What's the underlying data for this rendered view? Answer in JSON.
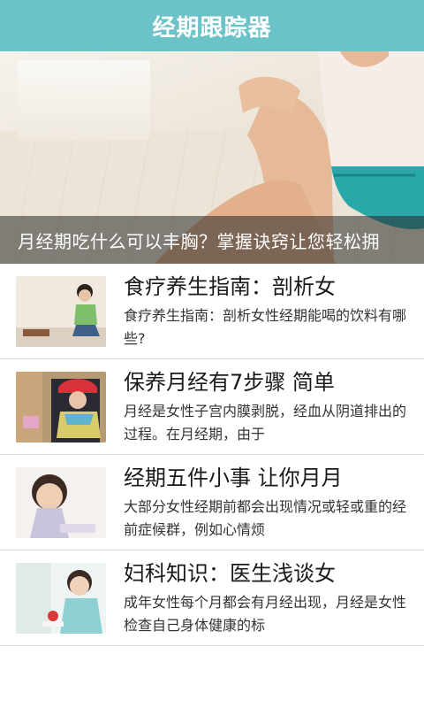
{
  "titlebar": {
    "title": "经期跟踪器"
  },
  "banner": {
    "caption": "月经期吃什么可以丰胸？掌握诀窍让您轻松拥",
    "image": "woman-stretching-photo"
  },
  "articles": [
    {
      "headline": "食疗养生指南：剖析女",
      "summary": "食疗养生指南：剖析女性经期能喝的饮料有哪些?",
      "thumb": "woman-sitting-photo"
    },
    {
      "headline": "保养月经有7步骤 简单",
      "summary": "月经是女性子宫内膜剥脱，经血从阴道排出的过程。在月经期，由于",
      "thumb": "woman-red-hat-photo"
    },
    {
      "headline": "经期五件小事 让你月月",
      "summary": "大部分女性经期前都会出现情况或轻或重的经前症候群，例如心情烦",
      "thumb": "smiling-woman-photo"
    },
    {
      "headline": "妇科知识：医生浅谈女",
      "summary": "成年女性每个月都会有月经出现，月经是女性检查自己身体健康的标",
      "thumb": "woman-holding-strawberry-photo"
    }
  ],
  "colors": {
    "titlebar": "#6cc3c7",
    "caption_overlay": "rgba(40,40,40,0.55)",
    "divider": "#dcdcdc"
  }
}
